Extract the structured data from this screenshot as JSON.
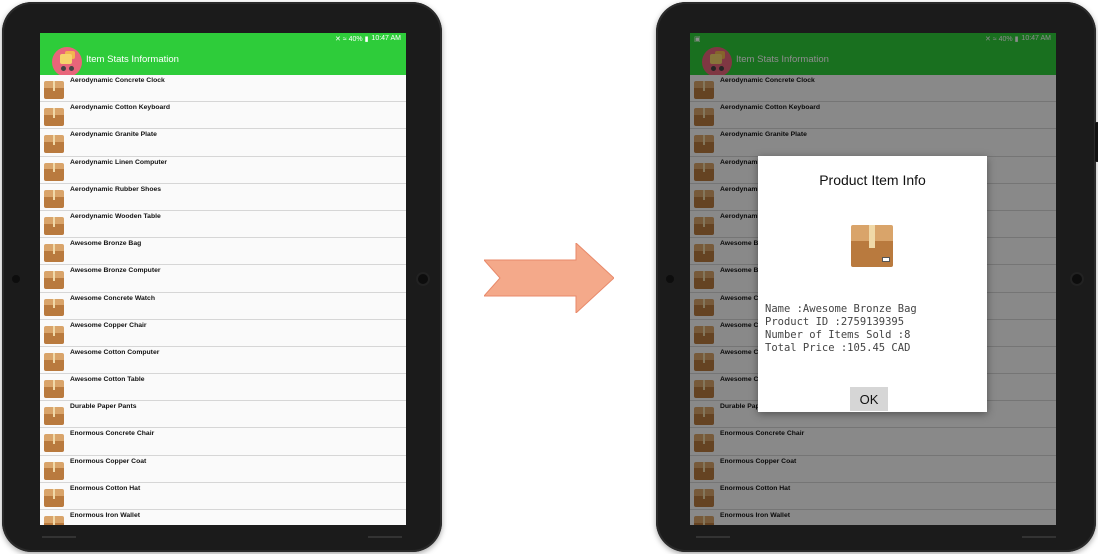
{
  "status": {
    "indicators": "✕ ≈ 40% ▮",
    "time": "10:47 AM",
    "notification_icon": "image-icon"
  },
  "app": {
    "title": "Item Stats Information",
    "logo": "shopping-cart-logo"
  },
  "items": [
    {
      "label": "Aerodynamic Concrete Clock"
    },
    {
      "label": "Aerodynamic Cotton Keyboard"
    },
    {
      "label": "Aerodynamic Granite Plate"
    },
    {
      "label": "Aerodynamic Linen Computer"
    },
    {
      "label": "Aerodynamic Rubber Shoes"
    },
    {
      "label": "Aerodynamic Wooden Table"
    },
    {
      "label": "Awesome Bronze Bag"
    },
    {
      "label": "Awesome Bronze Computer"
    },
    {
      "label": "Awesome Concrete Watch"
    },
    {
      "label": "Awesome Copper Chair"
    },
    {
      "label": "Awesome Cotton Computer"
    },
    {
      "label": "Awesome Cotton Table"
    },
    {
      "label": "Durable Paper Pants"
    },
    {
      "label": "Enormous Concrete Chair"
    },
    {
      "label": "Enormous Copper Coat"
    },
    {
      "label": "Enormous Cotton Hat"
    },
    {
      "label": "Enormous Iron Wallet"
    }
  ],
  "dialog": {
    "title": "Product Item Info",
    "icon": "package-box-icon",
    "lines": {
      "name": "Name :Awesome Bronze Bag",
      "product_id": "Product ID :2759139395",
      "items_sold": "Number of Items Sold :8",
      "total_price": "Total Price :105.45 CAD"
    },
    "ok_label": "OK"
  },
  "colors": {
    "appbar": "#2ecc3a",
    "arrow": "#f4a98a",
    "list_bg": "#fafafa"
  }
}
